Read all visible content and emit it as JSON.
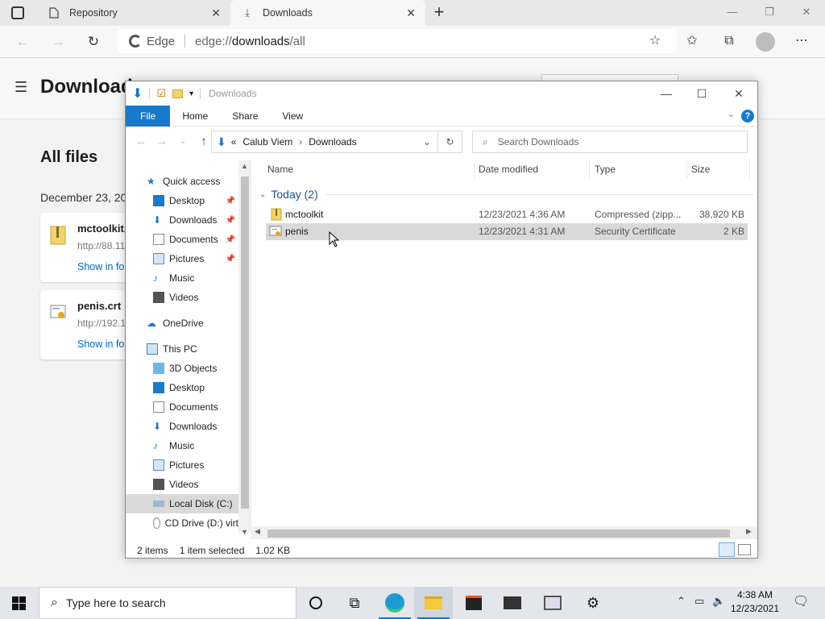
{
  "browser": {
    "tabs": [
      {
        "label": "Repository",
        "icon": "page-icon"
      },
      {
        "label": "Downloads",
        "icon": "download-icon"
      }
    ],
    "address": {
      "brand": "Edge",
      "url_prefix": "edge://",
      "url_main": "downloads",
      "url_suffix": "/all"
    }
  },
  "downloads_page": {
    "title": "Downloads",
    "section": "All files",
    "date_header": "December 23, 20",
    "items": [
      {
        "name": "mctoolkit.z",
        "source": "http://88.11",
        "link": "Show in fol"
      },
      {
        "name": "penis.crt",
        "source": "http://192.1",
        "link": "Show in fol"
      }
    ]
  },
  "explorer": {
    "title": "Downloads",
    "ribbon": {
      "file": "File",
      "home": "Home",
      "share": "Share",
      "view": "View"
    },
    "address": {
      "crumb_prefix": "«",
      "user": "Calub Viem",
      "folder": "Downloads"
    },
    "search_placeholder": "Search Downloads",
    "nav": {
      "quick_access": "Quick access",
      "desktop": "Desktop",
      "downloads": "Downloads",
      "documents": "Documents",
      "pictures": "Pictures",
      "music": "Music",
      "videos": "Videos",
      "onedrive": "OneDrive",
      "this_pc": "This PC",
      "objects3d": "3D Objects",
      "desktop2": "Desktop",
      "documents2": "Documents",
      "downloads2": "Downloads",
      "music2": "Music",
      "pictures2": "Pictures",
      "videos2": "Videos",
      "local_disk": "Local Disk (C:)",
      "cd_drive": "CD Drive (D:) virt"
    },
    "columns": {
      "name": "Name",
      "date": "Date modified",
      "type": "Type",
      "size": "Size"
    },
    "group": "Today (2)",
    "files": [
      {
        "name": "mctoolkit",
        "date": "12/23/2021 4:36 AM",
        "type": "Compressed (zipp...",
        "size": "38,920 KB"
      },
      {
        "name": "penis",
        "date": "12/23/2021 4:31 AM",
        "type": "Security Certificate",
        "size": "2 KB"
      }
    ],
    "status": {
      "count": "2 items",
      "selected": "1 item selected",
      "size": "1.02 KB"
    }
  },
  "taskbar": {
    "search_placeholder": "Type here to search",
    "time": "4:38 AM",
    "date": "12/23/2021"
  },
  "colors": {
    "accent": "#0078d7",
    "ribbon_file": "#1979ca",
    "link": "#0067c0"
  }
}
